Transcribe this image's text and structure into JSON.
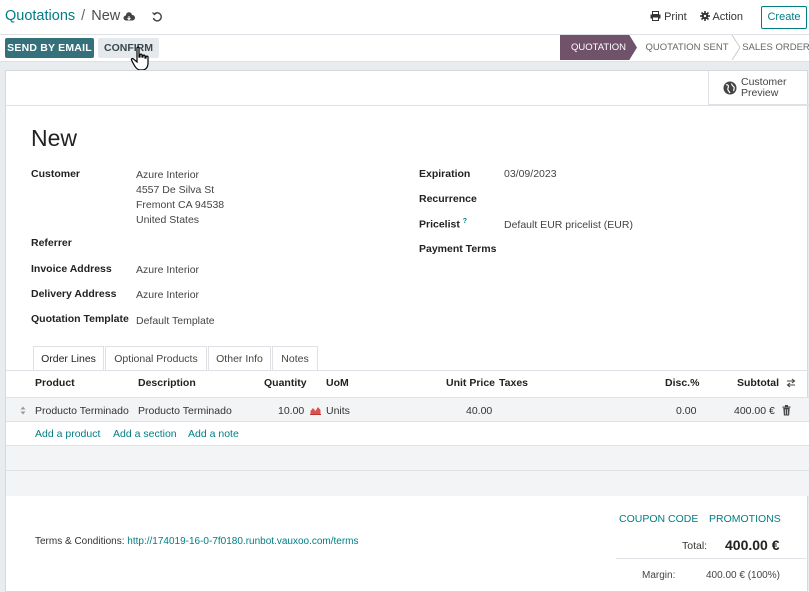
{
  "breadcrumb": {
    "parent": "Quotations",
    "separator": "/",
    "current": "New"
  },
  "topbar": {
    "print_label": "Print",
    "action_label": "Action",
    "create_label": "Create"
  },
  "controlbar": {
    "send_email_label": "SEND BY EMAIL",
    "confirm_label": "CONFIRM",
    "stages": [
      "QUOTATION",
      "QUOTATION SENT",
      "SALES ORDER"
    ],
    "active_stage": "QUOTATION"
  },
  "sheet": {
    "customer_preview_line1": "Customer",
    "customer_preview_line2": "Preview",
    "title": "New",
    "customer_label": "Customer",
    "customer_name": "Azure Interior",
    "customer_address": [
      "4557 De Silva St",
      "Fremont CA 94538",
      "United States"
    ],
    "referrer_label": "Referrer",
    "invoice_address_label": "Invoice Address",
    "invoice_address_value": "Azure Interior",
    "delivery_address_label": "Delivery Address",
    "delivery_address_value": "Azure Interior",
    "quotation_template_label": "Quotation Template",
    "quotation_template_value": "Default Template",
    "expiration_label": "Expiration",
    "expiration_value": "03/09/2023",
    "recurrence_label": "Recurrence",
    "pricelist_label": "Pricelist",
    "pricelist_help": "?",
    "pricelist_value": "Default EUR pricelist (EUR)",
    "payment_terms_label": "Payment Terms"
  },
  "tabs": [
    "Order Lines",
    "Optional Products",
    "Other Info",
    "Notes"
  ],
  "order_lines": {
    "columns": [
      "Product",
      "Description",
      "Quantity",
      "UoM",
      "Unit Price",
      "Taxes",
      "Disc.%",
      "Subtotal"
    ],
    "rows": [
      {
        "product": "Producto Terminado",
        "description": "Producto Terminado",
        "quantity": "10.00",
        "uom": "Units",
        "unit_price": "40.00",
        "taxes": "",
        "discount": "0.00",
        "subtotal": "400.00 €"
      }
    ],
    "add_product": "Add a product",
    "add_section": "Add a section",
    "add_note": "Add a note"
  },
  "footer": {
    "coupon_code": "COUPON CODE",
    "promotions": "PROMOTIONS",
    "terms_prefix": "Terms & Conditions:",
    "terms_url": "http://174019-16-0-7f0180.runbot.vauxoo.com/terms",
    "total_label": "Total:",
    "total_value": "400.00 €",
    "margin_label": "Margin:",
    "margin_value": "400.00 € (100%)"
  },
  "colors": {
    "accent": "#017e84",
    "primary_button": "#35717a",
    "active_stage": "#71526b"
  }
}
